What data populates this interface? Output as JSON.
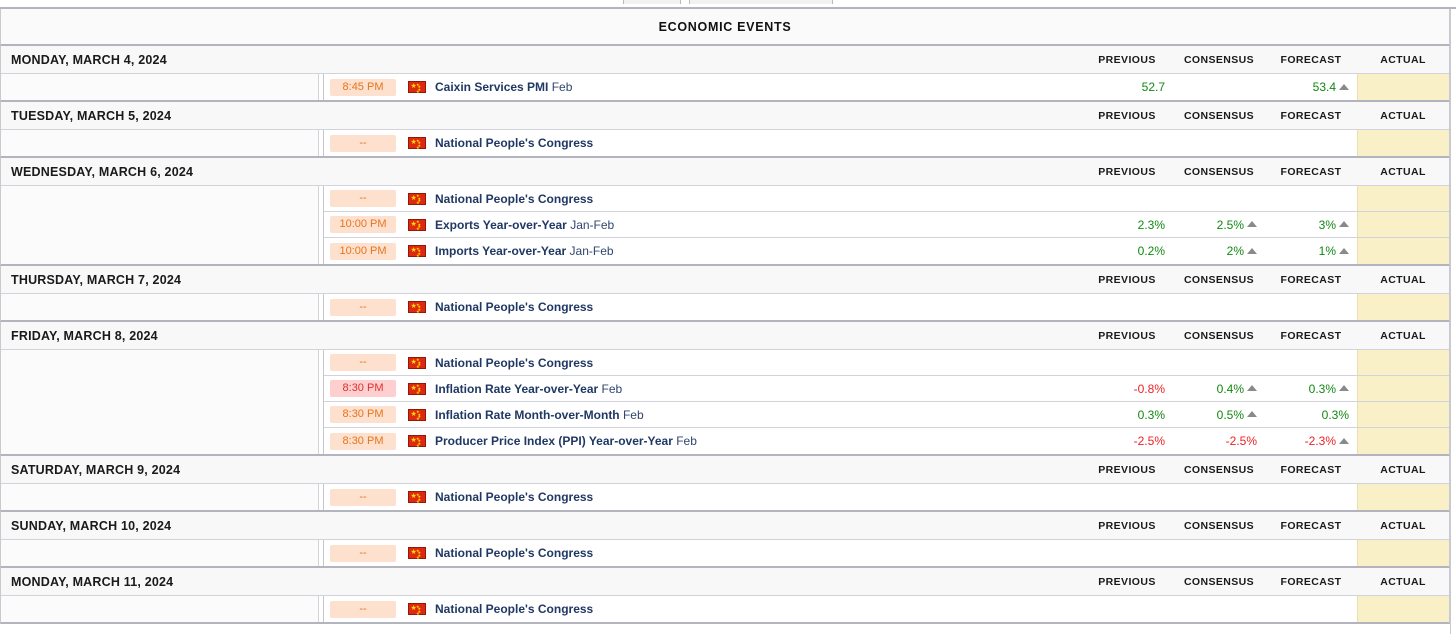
{
  "header": {
    "title": "ECONOMIC EVENTS"
  },
  "columns": {
    "previous": "PREVIOUS",
    "consensus": "CONSENSUS",
    "forecast": "FORECAST",
    "actual": "ACTUAL"
  },
  "colors": {
    "positive": "#118811",
    "negative": "#ee2222",
    "time_low": "#e8741c",
    "time_high": "#e03030",
    "time_low_bg": "#fde0cd",
    "time_high_bg": "#fdcfcf",
    "actual_bg": "#faf0c8",
    "event_name": "#1f3864"
  },
  "groups": [
    {
      "date": "MONDAY, MARCH 4, 2024",
      "events": [
        {
          "time": "8:45 PM",
          "importance": "low",
          "flag": "china-flag-icon",
          "name": "Caixin Services PMI",
          "period": "Feb",
          "previous": "52.7",
          "previous_sign": "pos",
          "previous_arrow": false,
          "consensus": "",
          "consensus_sign": "",
          "consensus_arrow": false,
          "forecast": "53.4",
          "forecast_sign": "pos",
          "forecast_arrow": true,
          "actual": ""
        }
      ]
    },
    {
      "date": "TUESDAY, MARCH 5, 2024",
      "events": [
        {
          "time": "--",
          "importance": "low",
          "flag": "china-flag-icon",
          "name": "National People's Congress",
          "period": "",
          "previous": "",
          "previous_sign": "",
          "previous_arrow": false,
          "consensus": "",
          "consensus_sign": "",
          "consensus_arrow": false,
          "forecast": "",
          "forecast_sign": "",
          "forecast_arrow": false,
          "actual": ""
        }
      ]
    },
    {
      "date": "WEDNESDAY, MARCH 6, 2024",
      "events": [
        {
          "time": "--",
          "importance": "low",
          "flag": "china-flag-icon",
          "name": "National People's Congress",
          "period": "",
          "previous": "",
          "previous_sign": "",
          "previous_arrow": false,
          "consensus": "",
          "consensus_sign": "",
          "consensus_arrow": false,
          "forecast": "",
          "forecast_sign": "",
          "forecast_arrow": false,
          "actual": ""
        },
        {
          "time": "10:00 PM",
          "importance": "low",
          "flag": "china-flag-icon",
          "name": "Exports Year-over-Year",
          "period": "Jan-Feb",
          "previous": "2.3%",
          "previous_sign": "pos",
          "previous_arrow": false,
          "consensus": "2.5%",
          "consensus_sign": "pos",
          "consensus_arrow": true,
          "forecast": "3%",
          "forecast_sign": "pos",
          "forecast_arrow": true,
          "actual": ""
        },
        {
          "time": "10:00 PM",
          "importance": "low",
          "flag": "china-flag-icon",
          "name": "Imports Year-over-Year",
          "period": "Jan-Feb",
          "previous": "0.2%",
          "previous_sign": "pos",
          "previous_arrow": false,
          "consensus": "2%",
          "consensus_sign": "pos",
          "consensus_arrow": true,
          "forecast": "1%",
          "forecast_sign": "pos",
          "forecast_arrow": true,
          "actual": ""
        }
      ]
    },
    {
      "date": "THURSDAY, MARCH 7, 2024",
      "events": [
        {
          "time": "--",
          "importance": "low",
          "flag": "china-flag-icon",
          "name": "National People's Congress",
          "period": "",
          "previous": "",
          "previous_sign": "",
          "previous_arrow": false,
          "consensus": "",
          "consensus_sign": "",
          "consensus_arrow": false,
          "forecast": "",
          "forecast_sign": "",
          "forecast_arrow": false,
          "actual": ""
        }
      ]
    },
    {
      "date": "FRIDAY, MARCH 8, 2024",
      "events": [
        {
          "time": "--",
          "importance": "low",
          "flag": "china-flag-icon",
          "name": "National People's Congress",
          "period": "",
          "previous": "",
          "previous_sign": "",
          "previous_arrow": false,
          "consensus": "",
          "consensus_sign": "",
          "consensus_arrow": false,
          "forecast": "",
          "forecast_sign": "",
          "forecast_arrow": false,
          "actual": ""
        },
        {
          "time": "8:30 PM",
          "importance": "high",
          "flag": "china-flag-icon",
          "name": "Inflation Rate Year-over-Year",
          "period": "Feb",
          "previous": "-0.8%",
          "previous_sign": "neg",
          "previous_arrow": false,
          "consensus": "0.4%",
          "consensus_sign": "pos",
          "consensus_arrow": true,
          "forecast": "0.3%",
          "forecast_sign": "pos",
          "forecast_arrow": true,
          "actual": ""
        },
        {
          "time": "8:30 PM",
          "importance": "low",
          "flag": "china-flag-icon",
          "name": "Inflation Rate Month-over-Month",
          "period": "Feb",
          "previous": "0.3%",
          "previous_sign": "pos",
          "previous_arrow": false,
          "consensus": "0.5%",
          "consensus_sign": "pos",
          "consensus_arrow": true,
          "forecast": "0.3%",
          "forecast_sign": "pos",
          "forecast_arrow": false,
          "actual": ""
        },
        {
          "time": "8:30 PM",
          "importance": "low",
          "flag": "china-flag-icon",
          "name": "Producer Price Index (PPI) Year-over-Year",
          "period": "Feb",
          "previous": "-2.5%",
          "previous_sign": "neg",
          "previous_arrow": false,
          "consensus": "-2.5%",
          "consensus_sign": "neg",
          "consensus_arrow": false,
          "forecast": "-2.3%",
          "forecast_sign": "neg",
          "forecast_arrow": true,
          "actual": ""
        }
      ]
    },
    {
      "date": "SATURDAY, MARCH 9, 2024",
      "events": [
        {
          "time": "--",
          "importance": "low",
          "flag": "china-flag-icon",
          "name": "National People's Congress",
          "period": "",
          "previous": "",
          "previous_sign": "",
          "previous_arrow": false,
          "consensus": "",
          "consensus_sign": "",
          "consensus_arrow": false,
          "forecast": "",
          "forecast_sign": "",
          "forecast_arrow": false,
          "actual": ""
        }
      ]
    },
    {
      "date": "SUNDAY, MARCH 10, 2024",
      "events": [
        {
          "time": "--",
          "importance": "low",
          "flag": "china-flag-icon",
          "name": "National People's Congress",
          "period": "",
          "previous": "",
          "previous_sign": "",
          "previous_arrow": false,
          "consensus": "",
          "consensus_sign": "",
          "consensus_arrow": false,
          "forecast": "",
          "forecast_sign": "",
          "forecast_arrow": false,
          "actual": ""
        }
      ]
    },
    {
      "date": "MONDAY, MARCH 11, 2024",
      "events": [
        {
          "time": "--",
          "importance": "low",
          "flag": "china-flag-icon",
          "name": "National People's Congress",
          "period": "",
          "previous": "",
          "previous_sign": "",
          "previous_arrow": false,
          "consensus": "",
          "consensus_sign": "",
          "consensus_arrow": false,
          "forecast": "",
          "forecast_sign": "",
          "forecast_arrow": false,
          "actual": ""
        }
      ]
    }
  ]
}
